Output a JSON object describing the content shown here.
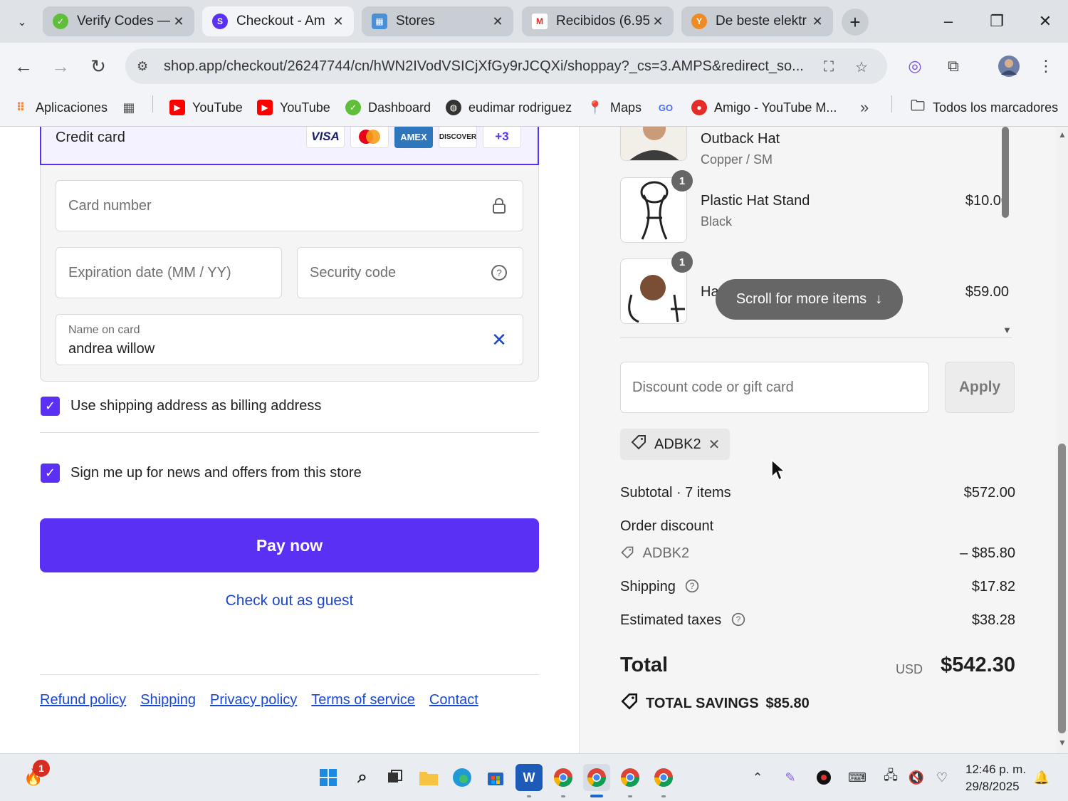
{
  "browser": {
    "tabs": [
      {
        "title": "Verify Codes —",
        "favicon": "green-leaf-icon"
      },
      {
        "title": "Checkout - Am",
        "favicon": "shop-logo-icon",
        "active": true
      },
      {
        "title": "Stores",
        "favicon": "maps-icon"
      },
      {
        "title": "Recibidos (6.95",
        "favicon": "gmail-icon"
      },
      {
        "title": "De beste elektr",
        "favicon": "orange-y-icon"
      }
    ],
    "url": "shop.app/checkout/26247744/cn/hWN2IVodVSICjXfGy9rJCQXi/shoppay?_cs=3.AMPS&redirect_so...",
    "bookmarks": [
      {
        "label": "Aplicaciones",
        "icon": "apps-grid-icon"
      },
      {
        "label": "",
        "icon": "tiles-icon"
      },
      {
        "label": "YouTube",
        "icon": "youtube-icon"
      },
      {
        "label": "YouTube",
        "icon": "youtube-icon"
      },
      {
        "label": "Dashboard",
        "icon": "green-leaf-icon"
      },
      {
        "label": "eudimar rodriguez",
        "icon": "globe-icon"
      },
      {
        "label": "Maps",
        "icon": "maps-pin-icon"
      },
      {
        "label": "",
        "icon": "go-icon"
      },
      {
        "label": "Amigo - YouTube M...",
        "icon": "music-icon"
      }
    ],
    "bookmarks_more": "»",
    "all_bookmarks": "Todos los marcadores"
  },
  "payment": {
    "method_label": "Credit card",
    "card_logos": [
      "VISA",
      "",
      "AMEX",
      "DISCOVER",
      "+3"
    ],
    "card_number_placeholder": "Card number",
    "expiry_placeholder": "Expiration date (MM / YY)",
    "security_placeholder": "Security code",
    "name_label": "Name on card",
    "name_value": "andrea willow"
  },
  "options": {
    "billing_same": "Use shipping address as billing address",
    "newsletter": "Sign me up for news and offers from this store"
  },
  "actions": {
    "pay_now": "Pay now",
    "guest": "Check out as guest"
  },
  "footer": {
    "links": [
      "Refund policy",
      "Shipping",
      "Privacy policy",
      "Terms of service",
      "Contact"
    ]
  },
  "order": {
    "items": [
      {
        "name": "Outback Hat",
        "variant": "Copper / SM",
        "price": "",
        "qty": ""
      },
      {
        "name": "Plastic Hat Stand",
        "variant": "Black",
        "price": "$10.00",
        "qty": "1"
      },
      {
        "name": "Ha",
        "variant": "",
        "price": "$59.00",
        "qty": "1"
      }
    ],
    "scroll_hint": "Scroll for more items",
    "discount_placeholder": "Discount code or gift card",
    "apply": "Apply",
    "applied_code": "ADBK2",
    "subtotal_label": "Subtotal · 7 items",
    "subtotal_value": "$572.00",
    "order_discount_label": "Order discount",
    "discount_code": "ADBK2",
    "discount_value": "– $85.80",
    "shipping_label": "Shipping",
    "shipping_value": "$17.82",
    "taxes_label": "Estimated taxes",
    "taxes_value": "$38.28",
    "total_label": "Total",
    "currency": "USD",
    "total_value": "$542.30",
    "savings_label": "TOTAL SAVINGS",
    "savings_value": "$85.80"
  },
  "taskbar": {
    "notification_count": "1",
    "time": "12:46 p. m.",
    "date": "29/8/2025"
  },
  "colors": {
    "accent": "#5a31f4",
    "link": "#1a47d1",
    "summary_bg": "#f5f5f5"
  }
}
